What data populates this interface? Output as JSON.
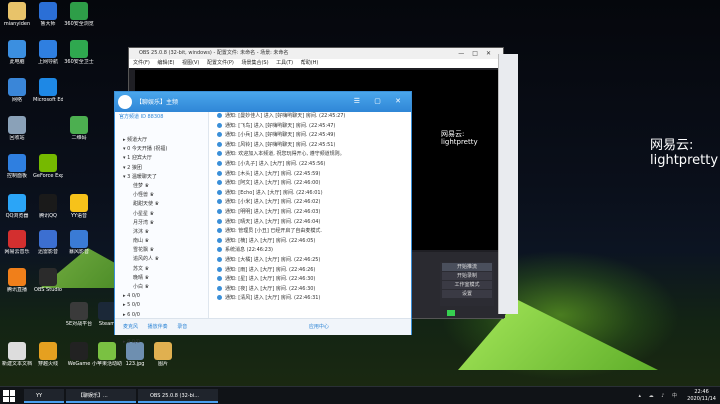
{
  "desktop": {
    "icons": [
      {
        "label": "mianyiden",
        "color": "#e8c36a"
      },
      {
        "label": "鲁大师",
        "color": "#2b6fd6"
      },
      {
        "label": "360安全浏览",
        "color": "#2e9e48"
      },
      {
        "label": "此电脑",
        "color": "#3b8fe0"
      },
      {
        "label": "上网导航",
        "color": "#2f7fe0"
      },
      {
        "label": "360安全卫士",
        "color": "#2fa84f"
      },
      {
        "label": "网络",
        "color": "#3a86d8"
      },
      {
        "label": "Microsoft Edge",
        "color": "#1e88e5"
      },
      {
        "label": "回收站",
        "color": "#8aa1b8"
      },
      {
        "label": "二维码",
        "color": "#4caf50"
      },
      {
        "label": "GeForce Experience",
        "color": "#76b900"
      },
      {
        "label": "控制面板",
        "color": "#2f7fe0"
      },
      {
        "label": "QQ浏览器",
        "color": "#2ba5f7"
      },
      {
        "label": "腾讯QQ",
        "color": "#1a1a1a"
      },
      {
        "label": "YY语音",
        "color": "#f7c21a"
      },
      {
        "label": "网易云音乐",
        "color": "#d32f2f"
      },
      {
        "label": "迅雷影音",
        "color": "#3c6fd1"
      },
      {
        "label": "暴风影音",
        "color": "#3a7bd5"
      },
      {
        "label": "OBS Studio",
        "color": "#2b2b2b"
      },
      {
        "label": "腾讯直播",
        "color": "#f07f1a"
      },
      {
        "label": "5E对战平台",
        "color": "#3a3a3a"
      },
      {
        "label": "Steam",
        "color": "#1b2838"
      },
      {
        "label": "新建文本文档",
        "color": "#dddddd"
      },
      {
        "label": "穿越火线",
        "color": "#e5a020"
      },
      {
        "label": "WeGame",
        "color": "#222222"
      },
      {
        "label": "小苹果活动助手",
        "color": "#7ac142"
      },
      {
        "label": "123.jpg",
        "color": "#6e8fb0"
      },
      {
        "label": "图片",
        "color": "#e0b050"
      }
    ]
  },
  "obs": {
    "title": "OBS 25.0.8 (32-bit, windows) - 配置文件: 未命名 - 场景: 未命名",
    "menu": [
      "文件(F)",
      "编辑(E)",
      "视图(V)",
      "配置文件(P)",
      "场景集合(S)",
      "工具(T)",
      "帮助(H)"
    ],
    "controls": [
      "开始推流",
      "开始录制",
      "工作室模式",
      "设置",
      "退出"
    ],
    "overlay_name_small": "网易云:\nlightpretty",
    "overlay_name_large": "网易云:\nlightpretty"
  },
  "yy": {
    "title": "【聊娱乐】主频",
    "channel_id": "官方频道  ID 88308",
    "tree": [
      {
        "t": "g",
        "text": "▸ 频道大厅"
      },
      {
        "t": "g",
        "text": "▾ 0 今天开播 (祝福)"
      },
      {
        "t": "g",
        "text": "▾ 1 迎宾大厅"
      },
      {
        "t": "g",
        "text": "▾ 2 狼团"
      },
      {
        "t": "g",
        "text": "▾ 3 温暖聊天了"
      },
      {
        "t": "u",
        "text": "佳梦 ♛"
      },
      {
        "t": "u",
        "text": "小怪兽 ♛"
      },
      {
        "t": "u",
        "text": "甜甜天使 ♛"
      },
      {
        "t": "u",
        "text": "小星星 ♛"
      },
      {
        "t": "u",
        "text": "月牙湾 ♛"
      },
      {
        "t": "u",
        "text": "沐沐 ♛"
      },
      {
        "t": "u",
        "text": "南山 ♛"
      },
      {
        "t": "u",
        "text": "雪花飘 ♛"
      },
      {
        "t": "u",
        "text": "追风的人 ♛"
      },
      {
        "t": "u",
        "text": "苏文 ♛"
      },
      {
        "t": "u",
        "text": "晚晴 ♛"
      },
      {
        "t": "u",
        "text": "小白 ♛"
      },
      {
        "t": "g",
        "text": "▸ 4 0/0"
      },
      {
        "t": "g",
        "text": "▸ 5 0/0"
      },
      {
        "t": "g",
        "text": "▸ 6 0/0"
      },
      {
        "t": "g",
        "text": "▸ 7 0/0"
      },
      {
        "t": "g",
        "text": "▸ 8 0/0"
      },
      {
        "t": "g",
        "text": "▸ 9 0/0"
      }
    ],
    "messages": [
      "通知: [曼妙佳人] 进入 [好嗨哟聊天] 房间. (22:45:27)",
      "通知: [飞鸟] 进入 [好嗨哟聊天] 房间. (22:45:47)",
      "通知: [小兵] 进入 [好嗨哟聊天] 房间. (22:45:49)",
      "通知: [风铃] 进入 [好嗨哟聊天] 房间. (22:45:51)",
      "通知: 欢迎加入本频道, 祝您玩得开心, 遵守频道规则。",
      "通知: [小丸子] 进入 [大厅] 房间. (22:45:56)",
      "通知: [木头] 进入 [大厅] 房间. (22:45:59)",
      "通知: [阿文] 进入 [大厅] 房间. (22:46:00)",
      "通知: [Echo] 进入 [大厅] 房间. (22:46:01)",
      "通知: [小米] 进入 [大厅] 房间. (22:46:02)",
      "通知: [明明] 进入 [大厅] 房间. (22:46:03)",
      "通知: [晴天] 进入 [大厅] 房间. (22:46:04)",
      "通知: 管理员 [小丑] 已经开启了自由麦模式.",
      "通知: [楠] 进入 [大厅] 房间. (22:46:05)",
      "系统消息 (22:46:23)",
      "通知: [大橘] 进入 [大厅] 房间. (22:46:25)",
      "通知: [雨] 进入 [大厅] 房间. (22:46:26)",
      "通知: [星] 进入 [大厅] 房间. (22:46:30)",
      "通知: [夜] 进入 [大厅] 房间. (22:46:30)",
      "通知: [清风] 进入 [大厅] 房间. (22:46:31)"
    ],
    "footer": [
      "麦克风",
      "播放伴奏",
      "录音",
      "应用中心"
    ]
  },
  "taskbar": {
    "items": [
      "YY",
      "【聊娱乐】...",
      "OBS 25.0.8 (32-bi..."
    ],
    "time": "22:46",
    "date": "2020/11/14"
  },
  "colors": {
    "yy_blue": "#2f86d6",
    "tent_green": "#8fd44a"
  }
}
